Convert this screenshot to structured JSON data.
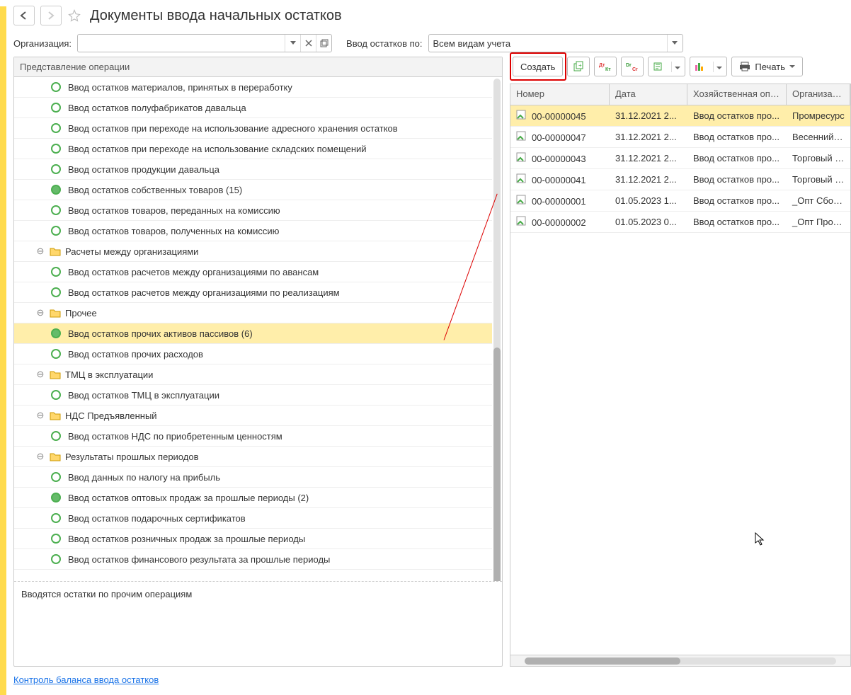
{
  "header": {
    "title": "Документы ввода начальных остатков"
  },
  "filters": {
    "org_label": "Организация:",
    "type_label": "Ввод остатков по:",
    "type_value": "Всем видам учета"
  },
  "tree": {
    "header": "Представление операции",
    "rows": [
      {
        "kind": "item",
        "state": "empty",
        "label": "Ввод остатков материалов, принятых в переработку"
      },
      {
        "kind": "item",
        "state": "empty",
        "label": "Ввод остатков полуфабрикатов давальца"
      },
      {
        "kind": "item",
        "state": "empty",
        "label": "Ввод остатков при переходе на использование адресного хранения остатков"
      },
      {
        "kind": "item",
        "state": "empty",
        "label": "Ввод остатков при переходе на использование складских помещений"
      },
      {
        "kind": "item",
        "state": "empty",
        "label": "Ввод остатков продукции давальца"
      },
      {
        "kind": "item",
        "state": "filled",
        "label": "Ввод остатков собственных товаров (15)"
      },
      {
        "kind": "item",
        "state": "empty",
        "label": "Ввод остатков товаров, переданных на комиссию"
      },
      {
        "kind": "item",
        "state": "empty",
        "label": "Ввод остатков товаров, полученных на комиссию"
      },
      {
        "kind": "folder",
        "label": "Расчеты между организациями"
      },
      {
        "kind": "item",
        "state": "empty",
        "label": "Ввод остатков расчетов между организациями по авансам"
      },
      {
        "kind": "item",
        "state": "empty",
        "label": "Ввод остатков расчетов между организациями по реализациям"
      },
      {
        "kind": "folder",
        "label": "Прочее"
      },
      {
        "kind": "item",
        "state": "filled",
        "selected": true,
        "label": "Ввод остатков прочих активов пассивов (6)"
      },
      {
        "kind": "item",
        "state": "empty",
        "label": "Ввод остатков прочих расходов"
      },
      {
        "kind": "folder",
        "label": "ТМЦ в эксплуатации"
      },
      {
        "kind": "item",
        "state": "empty",
        "label": "Ввод остатков ТМЦ в эксплуатации"
      },
      {
        "kind": "folder",
        "label": "НДС Предъявленный"
      },
      {
        "kind": "item",
        "state": "empty",
        "label": "Ввод остатков НДС по приобретенным ценностям"
      },
      {
        "kind": "folder",
        "label": "Результаты прошлых периодов"
      },
      {
        "kind": "item",
        "state": "empty",
        "label": "Ввод данных по налогу на прибыль"
      },
      {
        "kind": "item",
        "state": "filled",
        "label": "Ввод остатков оптовых продаж за прошлые периоды (2)"
      },
      {
        "kind": "item",
        "state": "empty",
        "label": "Ввод остатков подарочных сертификатов"
      },
      {
        "kind": "item",
        "state": "empty",
        "label": "Ввод остатков розничных продаж за прошлые периоды"
      },
      {
        "kind": "item",
        "state": "empty",
        "label": "Ввод остатков финансового результата за прошлые периоды"
      }
    ]
  },
  "hint": "Вводятся остатки по прочим операциям",
  "toolbar": {
    "create": "Создать",
    "print": "Печать"
  },
  "grid": {
    "headers": {
      "num": "Номер",
      "date": "Дата",
      "op": "Хозяйственная опе...",
      "org": "Организация"
    },
    "rows": [
      {
        "num": "00-00000045",
        "date": "31.12.2021 2...",
        "op": "Ввод остатков про...",
        "org": "Промресурс",
        "sel": true
      },
      {
        "num": "00-00000047",
        "date": "31.12.2021 2...",
        "op": "Ввод остатков про...",
        "org": "Весенний сад"
      },
      {
        "num": "00-00000043",
        "date": "31.12.2021 2...",
        "op": "Ввод остатков про...",
        "org": "Торговый дом"
      },
      {
        "num": "00-00000041",
        "date": "31.12.2021 2...",
        "op": "Ввод остатков про...",
        "org": "Торговый дом"
      },
      {
        "num": "00-00000001",
        "date": "01.05.2023 1...",
        "op": "Ввод остатков про...",
        "org": "_Опт Сборка"
      },
      {
        "num": "00-00000002",
        "date": "01.05.2023 0...",
        "op": "Ввод остатков про...",
        "org": "_Опт Продажи"
      }
    ]
  },
  "footer_link": "Контроль баланса ввода остатков"
}
